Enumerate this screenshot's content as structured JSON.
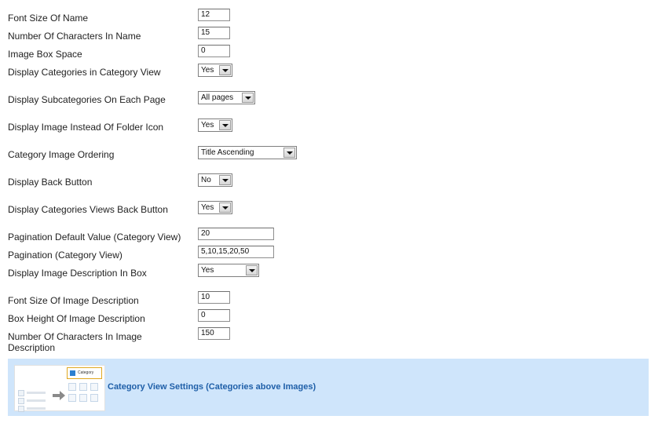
{
  "settings": [
    {
      "label": "Font Size Of Name",
      "control": "text",
      "value": "12"
    },
    {
      "label": "Number Of Characters In Name",
      "control": "text",
      "value": "15"
    },
    {
      "label": "Image Box Space",
      "control": "text",
      "value": "0"
    },
    {
      "label": "Display Categories in Category View",
      "control": "select",
      "value": "Yes"
    },
    {
      "label": "Display Subcategories On Each Page",
      "control": "select",
      "value": "All pages"
    },
    {
      "label": "Display Image Instead Of Folder Icon",
      "control": "select",
      "value": "Yes"
    },
    {
      "label": "Category Image Ordering",
      "control": "select",
      "value": "Title Ascending"
    },
    {
      "label": "Display Back Button",
      "control": "select",
      "value": "No"
    },
    {
      "label": "Display Categories Views Back Button",
      "control": "select",
      "value": "Yes"
    },
    {
      "label": "Pagination Default Value (Category View)",
      "control": "text",
      "value": "20"
    },
    {
      "label": "Pagination (Category View)",
      "control": "text",
      "value": "5,10,15,20,50"
    },
    {
      "label": "Display Image Description In Box",
      "control": "select",
      "value": "Yes"
    },
    {
      "label": "Font Size Of Image Description",
      "control": "text",
      "value": "10"
    },
    {
      "label": "Box Height Of Image Description",
      "control": "text",
      "value": "0"
    },
    {
      "label": "Number Of Characters In Image Description",
      "control": "text",
      "value": "150"
    }
  ],
  "banner": {
    "title": "Category View Settings (Categories above Images)",
    "thumbnail": {
      "icon": "category-layout-preview-icon",
      "box_label": "Category",
      "ghost_labels": [
        "category",
        "category",
        "category"
      ]
    }
  },
  "colors": {
    "banner_background": "#cfe5fb",
    "banner_title": "#1f5fa8",
    "thumbnail_highlight": "#e0a820",
    "thumbnail_square": "#2c7fd0"
  }
}
